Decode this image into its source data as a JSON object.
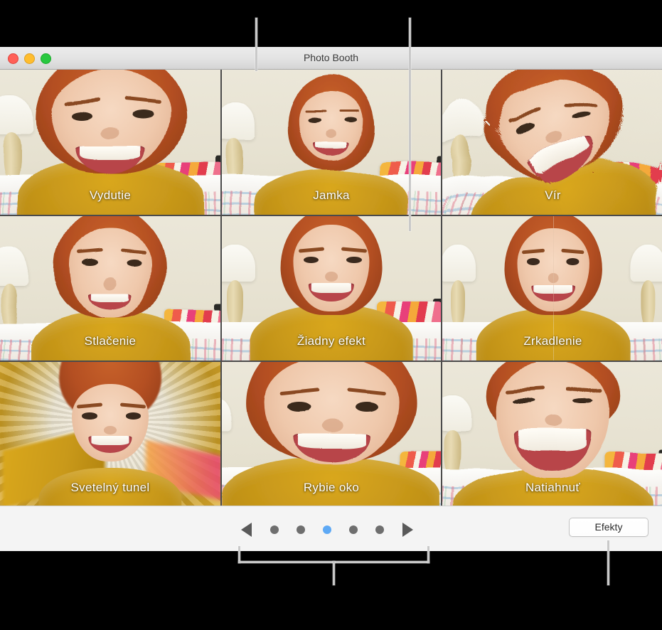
{
  "window": {
    "title": "Photo Booth",
    "traffic_lights": [
      {
        "name": "close",
        "color": "#ff5f57"
      },
      {
        "name": "minimize",
        "color": "#ffbd2e"
      },
      {
        "name": "zoom",
        "color": "#28c840"
      }
    ]
  },
  "effects_grid": {
    "columns": 3,
    "rows": 3,
    "cells": [
      {
        "label": "Vydutie",
        "effect": "bulge",
        "selected": false
      },
      {
        "label": "Jamka",
        "effect": "dent",
        "selected": false
      },
      {
        "label": "Vír",
        "effect": "twirl",
        "selected": false
      },
      {
        "label": "Stlačenie",
        "effect": "squeeze",
        "selected": false
      },
      {
        "label": "Žiadny efekt",
        "effect": "none",
        "selected": true
      },
      {
        "label": "Zrkadlenie",
        "effect": "mirror",
        "selected": false
      },
      {
        "label": "Svetelný tunel",
        "effect": "light-tunnel",
        "selected": false
      },
      {
        "label": "Rybie oko",
        "effect": "fisheye",
        "selected": false
      },
      {
        "label": "Natiahnuť",
        "effect": "stretch",
        "selected": false
      }
    ]
  },
  "bottom_bar": {
    "previous_page_label": "◀",
    "next_page_label": "▶",
    "pages": 5,
    "current_page": 3,
    "dot_color": "#6e6e6e",
    "active_dot_color": "#5ea9f5",
    "effects_button_label": "Efekty"
  },
  "callouts": [
    {
      "name": "effect-thumbnail-callout",
      "orientation": "vertical"
    },
    {
      "name": "selected-effect-callout",
      "orientation": "vertical"
    },
    {
      "name": "page-controls-callout",
      "orientation": "bracket"
    },
    {
      "name": "effects-button-callout",
      "orientation": "vertical"
    }
  ]
}
